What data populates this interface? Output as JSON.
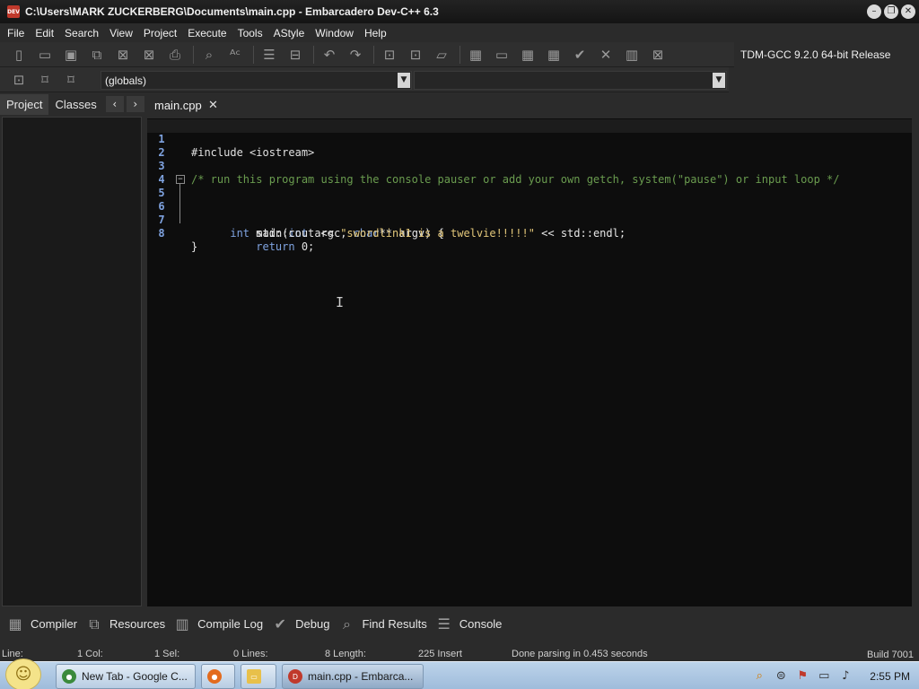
{
  "window": {
    "title": "C:\\Users\\MARK ZUCKERBERG\\Documents\\main.cpp - Embarcadero Dev-C++ 6.3",
    "app_icon_text": "DEV"
  },
  "menu": [
    "File",
    "Edit",
    "Search",
    "View",
    "Project",
    "Execute",
    "Tools",
    "AStyle",
    "Window",
    "Help"
  ],
  "toolbar": {
    "compiler": "TDM-GCC 9.2.0 64-bit Release",
    "globals_combo": "(globals)",
    "second_combo": ""
  },
  "left_panel": {
    "tabs": [
      "Project",
      "Classes"
    ]
  },
  "editor": {
    "tab_label": "main.cpp",
    "lines": [
      {
        "n": "1",
        "text": "#include <iostream>"
      },
      {
        "n": "2",
        "text": ""
      },
      {
        "n": "3",
        "text": "/* run this program using the console pauser or add your own getch, system(\"pause\") or input loop */"
      },
      {
        "n": "4",
        "text": ""
      },
      {
        "n": "5",
        "text": "int main(int argc, char** argv) {"
      },
      {
        "n": "6",
        "text": "    std::cout << \"swordlink1 is a twelvie!!!!!\" << std::endl;"
      },
      {
        "n": "7",
        "text": "    return 0;"
      },
      {
        "n": "8",
        "text": "}"
      }
    ],
    "code": {
      "l1": "#include <iostream>",
      "l3": "/* run this program using the console pauser or add your own getch, system(\"pause\") or input loop */",
      "l5_kw1": "int",
      "l5_a": " main(",
      "l5_kw2": "int",
      "l5_b": " argc, ",
      "l5_kw3": "char",
      "l5_c": "** argv) {",
      "l6_a": "    std::cout << ",
      "l6_str": "\"swordlink1 is a twelvie!!!!!\"",
      "l6_b": " << std::endl;",
      "l7_kw": "    return",
      "l7_b": " 0;",
      "l8": "}"
    }
  },
  "bottom_tabs": [
    "Compiler",
    "Resources",
    "Compile Log",
    "Debug",
    "Find Results",
    "Console"
  ],
  "status": {
    "line": "Line:",
    "col": "1 Col:",
    "sel": "1 Sel:",
    "lines": "0 Lines:",
    "length": "8 Length:",
    "insert": "225 Insert",
    "parsing": "Done parsing in 0.453 seconds",
    "build": "Build 7001"
  },
  "taskbar": {
    "items": [
      "New Tab - Google C...",
      "",
      "",
      "main.cpp - Embarca..."
    ],
    "clock": "2:55 PM"
  }
}
